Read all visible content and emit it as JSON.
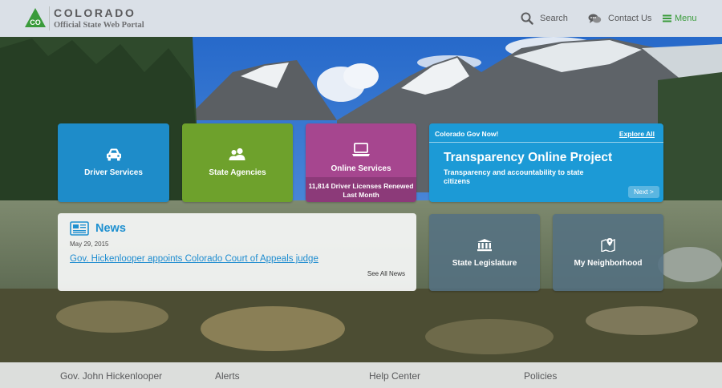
{
  "header": {
    "brand_title": "COLORADO",
    "brand_subtitle": "Official State Web Portal",
    "logo_text": "CO",
    "nav": {
      "search_label": "Search",
      "contact_label": "Contact Us",
      "menu_label": "Menu"
    }
  },
  "tiles": {
    "driver_services": "Driver Services",
    "state_agencies": "State Agencies",
    "online_services": "Online Services",
    "online_services_stat": "11,814 Driver Licenses Renewed Last Month",
    "state_legislature": "State Legislature",
    "my_neighborhood": "My Neighborhood"
  },
  "colorado_gov_now": {
    "title": "Colorado Gov Now!",
    "explore_label": "Explore All",
    "headline": "Transparency Online Project",
    "description": "Transparency and accountability to state citizens",
    "next_label": "Next >"
  },
  "news": {
    "heading": "News",
    "date": "May 29, 2015",
    "headline": "Gov. Hickenlooper appoints Colorado Court of Appeals judge",
    "see_all_label": "See All News"
  },
  "footer": {
    "links": [
      "Gov. John Hickenlooper",
      "Alerts",
      "Help Center",
      "Policies"
    ]
  },
  "colors": {
    "driver": "#1e8cc9",
    "agencies": "#6ea12c",
    "online": "#a6468f",
    "gov_now": "#1c9ad6",
    "slate": "#547182",
    "brand_green": "#3a9b3b"
  }
}
